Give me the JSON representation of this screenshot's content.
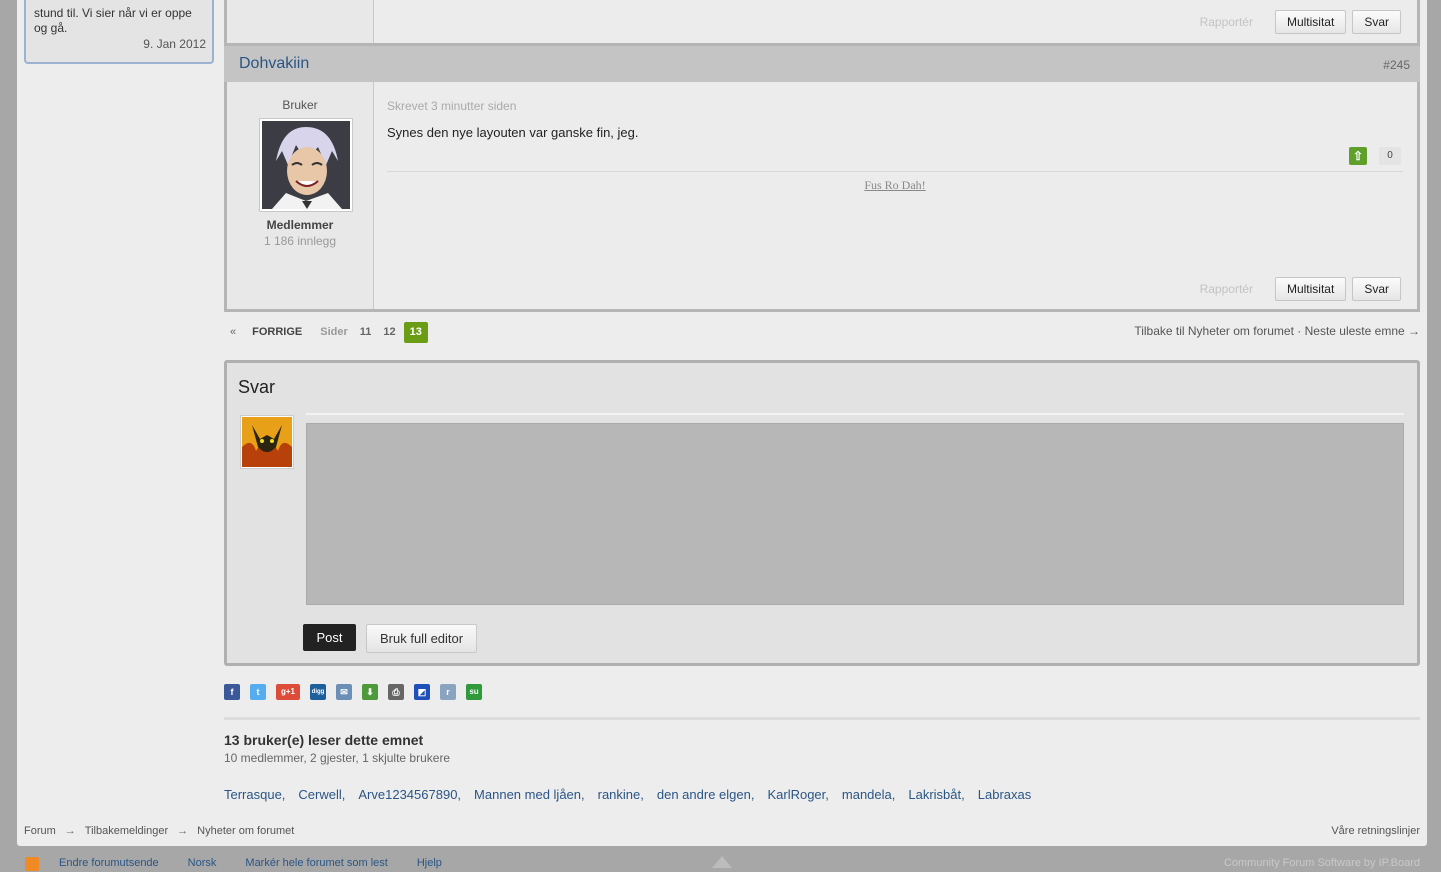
{
  "sidebar_card": {
    "text": "stund til. Vi sier når vi er oppe og gå.",
    "date": "9. Jan 2012"
  },
  "prev_post": {
    "report": "Rapportér",
    "multiquote": "Multisitat",
    "reply": "Svar"
  },
  "post": {
    "author": "Dohvakiin",
    "number": "#245",
    "rank_title": "Bruker",
    "group": "Medlemmer",
    "post_count": "1 186 innlegg",
    "timestamp": "Skrevet 3 minutter siden",
    "message": "Synes den nye layouten var ganske fin, jeg.",
    "vote_up": "⇧",
    "votes": "0",
    "signature": "Fus Ro Dah!",
    "report": "Rapportér",
    "multiquote": "Multisitat",
    "reply": "Svar"
  },
  "pagination": {
    "first": "«",
    "prev": "FORRIGE",
    "pages_label": "Sider",
    "pages": [
      "11",
      "12"
    ],
    "current": "13"
  },
  "topic_nav": {
    "back": "Tilbake til Nyheter om forumet",
    "sep": "·",
    "next": "Neste uleste emne →"
  },
  "reply_box": {
    "title": "Svar",
    "post_button": "Post",
    "full_editor_button": "Bruk full editor"
  },
  "share_icons": [
    {
      "name": "facebook-icon",
      "label": "f",
      "color": "#3b5998"
    },
    {
      "name": "twitter-icon",
      "label": "t",
      "color": "#55acee"
    },
    {
      "name": "googleplus-icon",
      "label": "g+1",
      "color": "#dd4b39"
    },
    {
      "name": "digg-icon",
      "label": "digg",
      "color": "#1d5f9b"
    },
    {
      "name": "email-icon",
      "label": "✉",
      "color": "#6c8fb8"
    },
    {
      "name": "download-icon",
      "label": "⬇",
      "color": "#4c9a3a"
    },
    {
      "name": "print-icon",
      "label": "⎙",
      "color": "#666666"
    },
    {
      "name": "delicious-icon",
      "label": "◩",
      "color": "#1f4fb8"
    },
    {
      "name": "reddit-icon",
      "label": "r",
      "color": "#8aa3c0"
    },
    {
      "name": "stumbleupon-icon",
      "label": "su",
      "color": "#2e9a3a"
    }
  ],
  "readers": {
    "title": "13 bruker(e) leser dette emnet",
    "subtitle": "10 medlemmer, 2 gjester, 1 skjulte brukere",
    "users": [
      "Terrasque,",
      "Cerwell,",
      "Arve1234567890,",
      "Mannen med ljåen,",
      "rankine,",
      "den andre elgen,",
      "KarlRoger,",
      "mandela,",
      "Lakrisbåt,",
      "Labraxas"
    ]
  },
  "breadcrumb": {
    "items": [
      "Forum",
      "Tilbakemeldinger",
      "Nyheter om forumet"
    ],
    "sep": "→"
  },
  "guidelines": "Våre retningslinjer",
  "bottom_links": [
    "Endre forumutsende",
    "Norsk",
    "Markér hele forumet som lest",
    "Hjelp"
  ],
  "credits": "Community Forum Software by IP.Board",
  "colors": {
    "link": "#2a5585",
    "accent_green": "#6a9c14",
    "background": "#a7a7a7"
  }
}
